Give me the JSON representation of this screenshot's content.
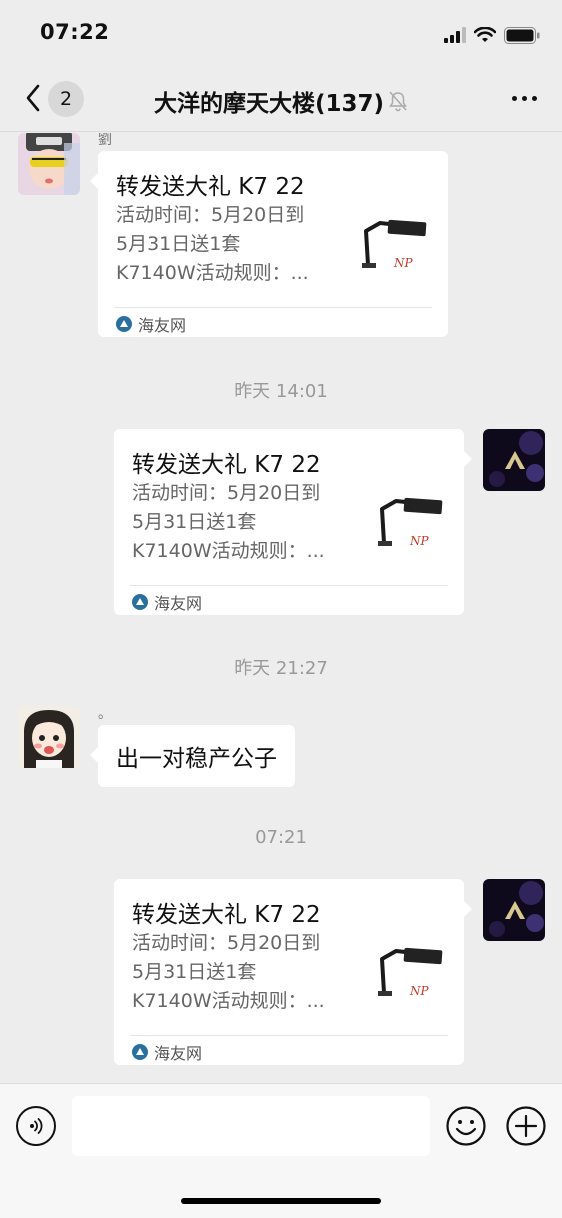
{
  "status_bar": {
    "time": "07:22"
  },
  "nav": {
    "unread_count": "2",
    "title": "大洋的摩天大楼(137)"
  },
  "messages": {
    "msg1": {
      "sender_name": "劉",
      "card": {
        "title": "转发送大礼 K7 22",
        "desc_line1": "活动时间：5月20日到",
        "desc_line2": "5月31日送1套",
        "desc_line3": "K7140W活动规则：...",
        "source": "海友网"
      }
    },
    "time1": "昨天 14:01",
    "msg2": {
      "card": {
        "title": "转发送大礼 K7 22",
        "desc_line1": "活动时间：5月20日到",
        "desc_line2": "5月31日送1套",
        "desc_line3": "K7140W活动规则：...",
        "source": "海友网"
      }
    },
    "time2": "昨天 21:27",
    "msg3": {
      "sender_name": "。",
      "text": "出一对稳产公子"
    },
    "time3": "07:21",
    "msg4": {
      "card": {
        "title": "转发送大礼 K7 22",
        "desc_line1": "活动时间：5月20日到",
        "desc_line2": "5月31日送1套",
        "desc_line3": "K7140W活动规则：...",
        "source": "海友网"
      }
    }
  },
  "thumb_logo_text": "NP",
  "colors": {
    "background": "#ededed",
    "bubble": "#ffffff",
    "muted_text": "#999999"
  },
  "icons": [
    "back-chevron-icon",
    "mute-bell-icon",
    "more-dots-icon",
    "voice-icon",
    "emoji-icon",
    "plus-icon"
  ]
}
